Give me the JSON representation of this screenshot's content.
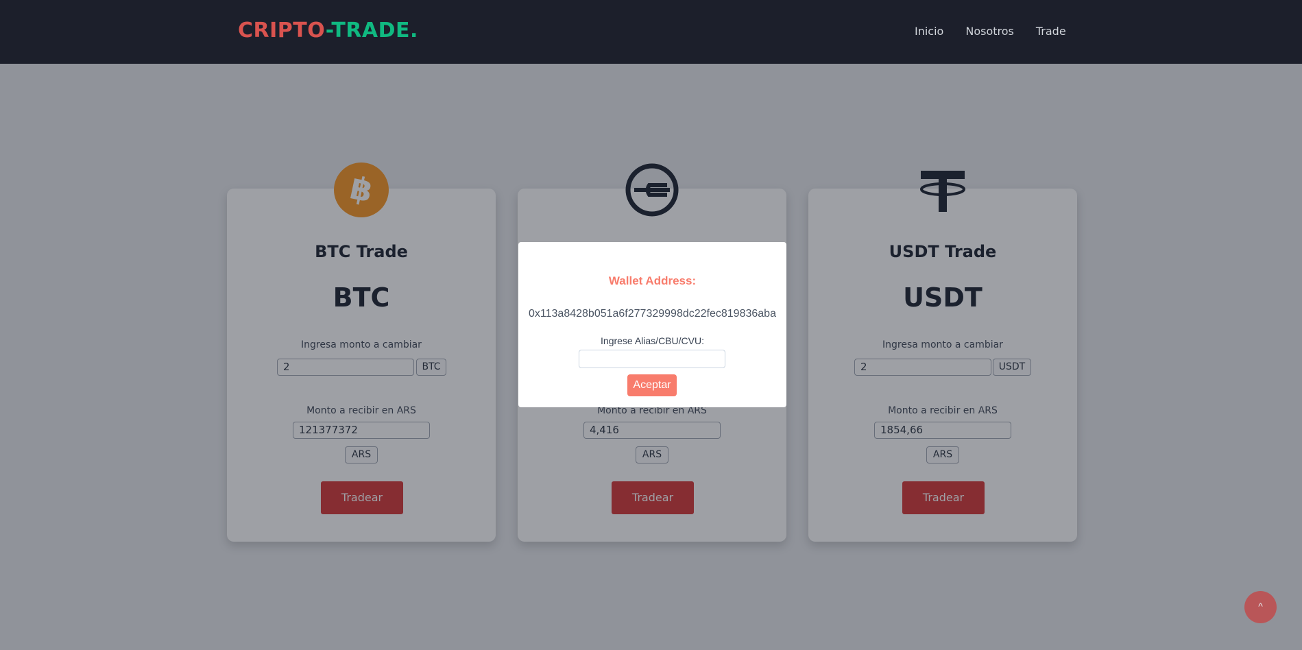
{
  "brand": {
    "part1": "CRIPTO",
    "part2": "-TRADE."
  },
  "nav": {
    "items": [
      "Inicio",
      "Nosotros",
      "Trade"
    ]
  },
  "cards": [
    {
      "title": "BTC Trade",
      "symbol": "BTC",
      "amount_label": "Ingresa monto a cambiar",
      "amount_value": "2",
      "amount_unit": "BTC",
      "receive_label": "Monto a recibir en ARS",
      "receive_value": "121377372",
      "receive_unit": "ARS",
      "button": "Tradear",
      "icon": "bitcoin-icon"
    },
    {
      "title": "",
      "symbol": "",
      "amount_label": "",
      "amount_value": "",
      "amount_unit": "",
      "receive_label": "Monto a recibir en ARS",
      "receive_value": "4,416",
      "receive_unit": "ARS",
      "button": "Tradear",
      "icon": "worldcoin-icon"
    },
    {
      "title": "USDT Trade",
      "symbol": "USDT",
      "amount_label": "Ingresa monto a cambiar",
      "amount_value": "2",
      "amount_unit": "USDT",
      "receive_label": "Monto a recibir en ARS",
      "receive_value": "1854,66",
      "receive_unit": "ARS",
      "button": "Tradear",
      "icon": "tether-icon"
    }
  ],
  "modal": {
    "title": "Wallet Address:",
    "address": "0x113a8428b051a6f277329998dc22fec819836aba",
    "label": "Ingrese Alias/CBU/CVU:",
    "input_value": "",
    "button": "Aceptar"
  },
  "scroll_top": {
    "label": "^"
  },
  "colors": {
    "navbar": "#1c1f2b",
    "brand_red": "#d9534f",
    "brand_green": "#10b981",
    "accent": "#f87c6c"
  }
}
